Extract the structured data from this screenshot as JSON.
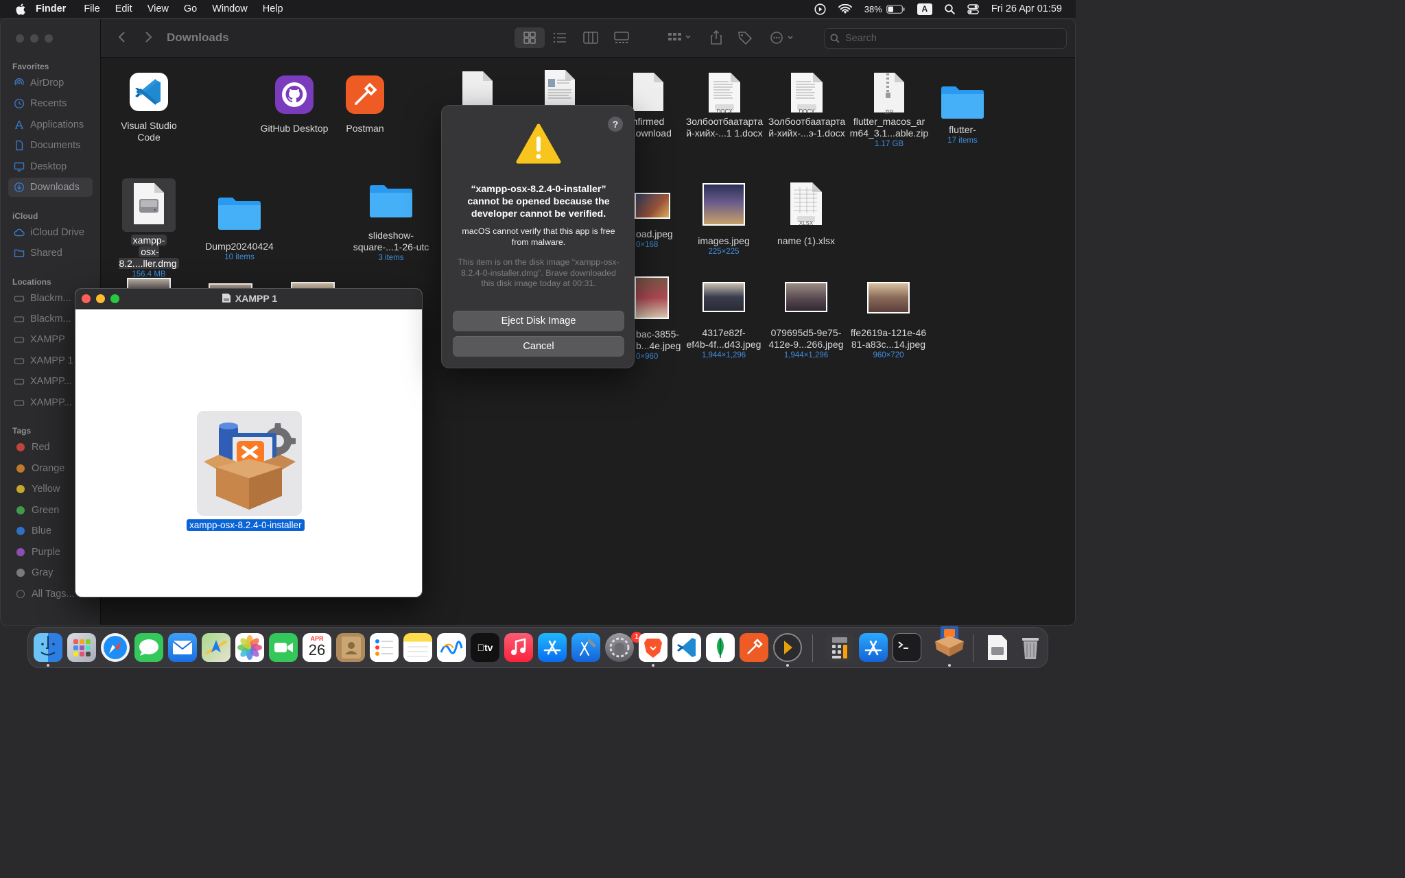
{
  "menubar": {
    "app_name": "Finder",
    "menus": [
      "File",
      "Edit",
      "View",
      "Go",
      "Window",
      "Help"
    ],
    "battery_percent": "38%",
    "input_source": "A",
    "datetime": "Fri 26 Apr  01:59"
  },
  "finder": {
    "title": "Downloads",
    "search_placeholder": "Search",
    "sidebar": {
      "favorites_header": "Favorites",
      "favorites": [
        "AirDrop",
        "Recents",
        "Applications",
        "Documents",
        "Desktop",
        "Downloads"
      ],
      "icloud_header": "iCloud",
      "icloud": [
        "iCloud Drive",
        "Shared"
      ],
      "locations_header": "Locations",
      "locations": [
        "Blackm...",
        "Blackm...",
        "XAMPP",
        "XAMPP 1",
        "XAMPP...",
        "XAMPP..."
      ],
      "tags_header": "Tags",
      "tags": [
        {
          "label": "Red",
          "color": "#c2433d"
        },
        {
          "label": "Orange",
          "color": "#c0782a"
        },
        {
          "label": "Yellow",
          "color": "#c4a82d"
        },
        {
          "label": "Green",
          "color": "#3f9a4a"
        },
        {
          "label": "Blue",
          "color": "#2f6fc4"
        },
        {
          "label": "Purple",
          "color": "#8a4fb0"
        },
        {
          "label": "Gray",
          "color": "#7a7a7e"
        },
        {
          "label": "All Tags...",
          "color": ""
        }
      ]
    },
    "files": {
      "vscode": {
        "name1": "Visual Studio",
        "name2": "Code"
      },
      "github": {
        "name": "GitHub Desktop"
      },
      "postman": {
        "name": "Postman"
      },
      "unconfirmed": {
        "name1": "nfirmed",
        "name2": "....ownload"
      },
      "docx1": {
        "name1": "Золбоотбаатарта",
        "name2": "й-хийх-...1 1.docx"
      },
      "docx2": {
        "name1": "Золбоотбаатарта",
        "name2": "й-хийх-...э-1.docx"
      },
      "zip": {
        "name1": "flutter_macos_ar",
        "name2": "m64_3.1...able.zip",
        "sub": "1.17 GB"
      },
      "flutter": {
        "name": "flutter-",
        "sub": "17 items"
      },
      "dmg": {
        "name1": "xampp-",
        "name2": "osx-8.2....ller.dmg",
        "sub": "156.4 MB"
      },
      "dump": {
        "name": "Dump20240424",
        "sub": "10 items"
      },
      "slideshow": {
        "name1": "slideshow-",
        "name2": "square-...1-26-utc",
        "sub": "3 items"
      },
      "download_jpeg": {
        "name": "oad.jpeg",
        "sub": "0×168"
      },
      "images_jpeg": {
        "name": "images.jpeg",
        "sub": "225×225"
      },
      "xlsx": {
        "name": "name (1).xlsx"
      },
      "jpeg_3855": {
        "name1": "bac-3855-",
        "name2": "b...4e.jpeg",
        "sub": "0×960"
      },
      "jpeg_4317": {
        "name1": "4317e82f-",
        "name2": "ef4b-4f...d43.jpeg",
        "sub": "1,944×1,296"
      },
      "jpeg_0796": {
        "name1": "079695d5-9e75-",
        "name2": "412e-9...266.jpeg",
        "sub": "1,944×1,296"
      },
      "jpeg_ffe2": {
        "name1": "ffe2619a-121e-46",
        "name2": "81-a83c...14.jpeg",
        "sub": "960×720"
      },
      "doc_badge": "DOCX",
      "zip_badge": "ZIP",
      "xlsx_badge": "XLSX"
    }
  },
  "alert": {
    "title": "“xampp-osx-8.2.4-0-installer” cannot be opened because the developer cannot be verified.",
    "message": "macOS cannot verify that this app is free from malware.",
    "info": "This item is on the disk image “xampp-osx-8.2.4-0-installer.dmg”. Brave downloaded this disk image today at 00:31.",
    "help": "?",
    "eject_button": "Eject Disk Image",
    "cancel_button": "Cancel"
  },
  "xampp_window": {
    "title": "XAMPP 1",
    "item_label": "xampp-osx-8.2.4-0-installer"
  },
  "dock": {
    "calendar_month": "APR",
    "calendar_day": "26",
    "tv_label": "tv",
    "settings_badge": "1",
    "apps": [
      "finder-icon",
      "launchpad-icon",
      "safari-icon",
      "messages-icon",
      "mail-icon",
      "maps-icon",
      "photos-icon",
      "facetime-icon",
      "calendar-icon",
      "contacts-icon",
      "reminders-icon",
      "notes-icon",
      "freeform-icon",
      "appletv-icon",
      "music-icon",
      "appstore-icon",
      "xcode-icon",
      "system-settings-icon",
      "brave-icon",
      "vscode-icon",
      "mongodb-compass-icon",
      "postman-icon",
      "plex-icon",
      "calculator-icon",
      "app-installer-icon",
      "terminal-icon",
      "xampp-icon",
      "disk-image-icon",
      "trash-icon"
    ]
  }
}
